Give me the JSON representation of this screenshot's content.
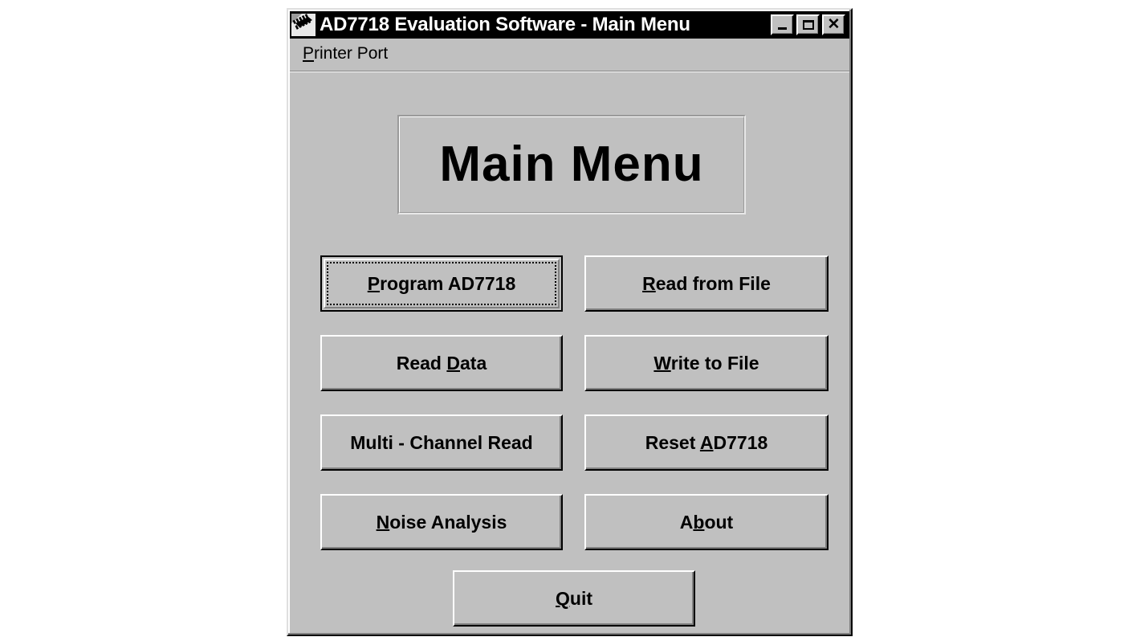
{
  "window": {
    "title": "AD7718 Evaluation Software - Main Menu",
    "icon": "ic-chip-icon",
    "controls": {
      "minimize": "_",
      "maximize": "□",
      "close": "✕"
    }
  },
  "menubar": {
    "items": [
      {
        "label": "Printer Port",
        "accel_prefix": "P",
        "accel_rest": "rinter Port"
      }
    ]
  },
  "heading": {
    "text": "Main Menu"
  },
  "buttons": [
    {
      "id": "program-ad7718",
      "pre": "",
      "accel": "P",
      "post": "rogram AD7718",
      "focused": true,
      "col": "left",
      "row": 1
    },
    {
      "id": "read-from-file",
      "pre": "",
      "accel": "R",
      "post": "ead from File",
      "focused": false,
      "col": "right",
      "row": 1
    },
    {
      "id": "read-data",
      "pre": "Read ",
      "accel": "D",
      "post": "ata",
      "focused": false,
      "col": "left",
      "row": 2
    },
    {
      "id": "write-to-file",
      "pre": "",
      "accel": "W",
      "post": "rite to File",
      "focused": false,
      "col": "right",
      "row": 2
    },
    {
      "id": "multi-channel-read",
      "pre": "Multi - Channel Read",
      "accel": "",
      "post": "",
      "focused": false,
      "col": "left",
      "row": 3
    },
    {
      "id": "reset-ad7718",
      "pre": "Reset ",
      "accel": "A",
      "post": "D7718",
      "focused": false,
      "col": "right",
      "row": 3
    },
    {
      "id": "noise-analysis",
      "pre": "",
      "accel": "N",
      "post": "oise Analysis",
      "focused": false,
      "col": "left",
      "row": 4
    },
    {
      "id": "about",
      "pre": "A",
      "accel": "b",
      "post": "out",
      "focused": false,
      "col": "right",
      "row": 4
    },
    {
      "id": "quit",
      "pre": "",
      "accel": "Q",
      "post": "uit",
      "focused": false,
      "col": "center",
      "row": 5
    }
  ],
  "colors": {
    "face": "#c0c0c0",
    "titlebar": "#000000",
    "titlebar_text": "#ffffff",
    "page_background": "#ffffff",
    "highlight": "#ffffff",
    "shadow": "#808080",
    "dark_shadow": "#000000"
  }
}
